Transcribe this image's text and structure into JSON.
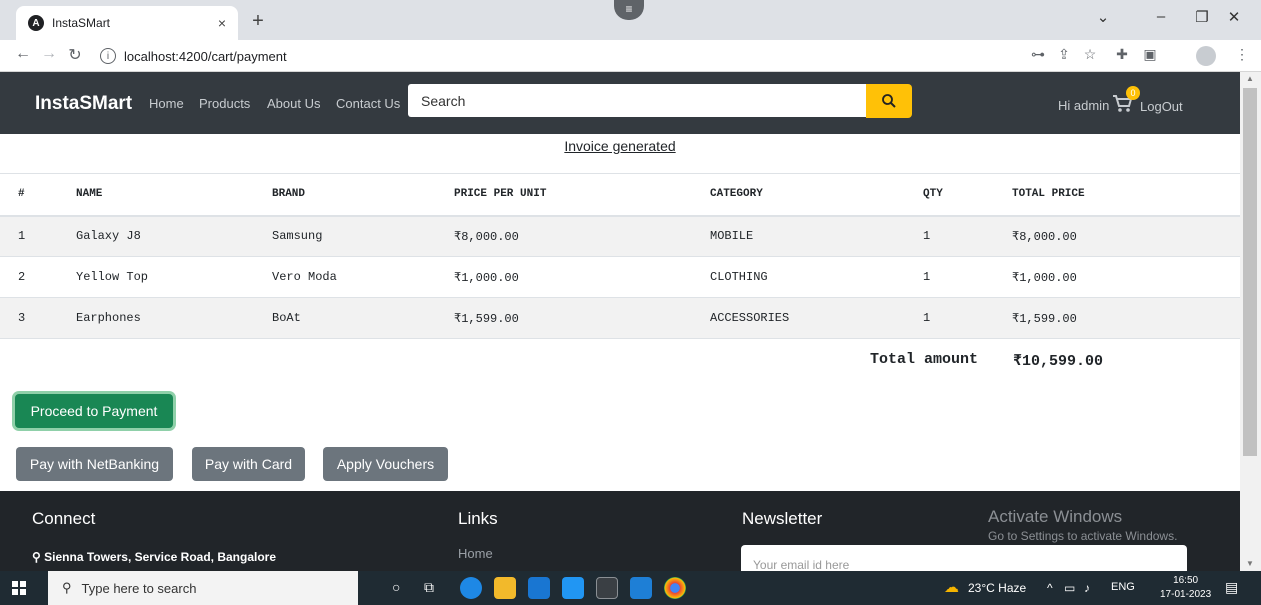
{
  "browser": {
    "tab_title": "InstaSMart",
    "tab_close": "×",
    "new_tab": "+",
    "url": "localhost:4200/cart/payment"
  },
  "navbar": {
    "brand": "InstaSMart",
    "links": [
      "Home",
      "Products",
      "About Us",
      "Contact Us"
    ],
    "search_placeholder": "Search",
    "greeting": "Hi admin",
    "cart_count": "0",
    "logout": "LogOut",
    "accent_color": "#ffc107"
  },
  "invoice": {
    "title": "Invoice generated",
    "headers": [
      "#",
      "NAME",
      "BRAND",
      "PRICE PER UNIT",
      "CATEGORY",
      "QTY",
      "TOTAL PRICE"
    ],
    "rows": [
      [
        "1",
        "Galaxy J8",
        "Samsung",
        "₹8,000.00",
        "MOBILE",
        "1",
        "₹8,000.00"
      ],
      [
        "2",
        "Yellow Top",
        "Vero Moda",
        "₹1,000.00",
        "CLOTHING",
        "1",
        "₹1,000.00"
      ],
      [
        "3",
        "Earphones",
        "BoAt",
        "₹1,599.00",
        "ACCESSORIES",
        "1",
        "₹1,599.00"
      ]
    ],
    "total_label": "Total amount",
    "total_value": "₹10,599.00"
  },
  "actions": {
    "proceed": "Proceed to Payment",
    "netbanking": "Pay with NetBanking",
    "card": "Pay with Card",
    "vouchers": "Apply Vouchers"
  },
  "footer": {
    "connect_heading": "Connect",
    "address": "Sienna Towers, Service Road, Bangalore",
    "links_heading": "Links",
    "link_home": "Home",
    "newsletter_heading": "Newsletter",
    "email_placeholder": "Your email id here"
  },
  "watermark": {
    "line1": "Activate Windows",
    "line2": "Go to Settings to activate Windows."
  },
  "taskbar": {
    "search_placeholder": "Type here to search",
    "weather": "23°C  Haze",
    "lang": "ENG",
    "time": "16:50",
    "date": "17-01-2023"
  }
}
